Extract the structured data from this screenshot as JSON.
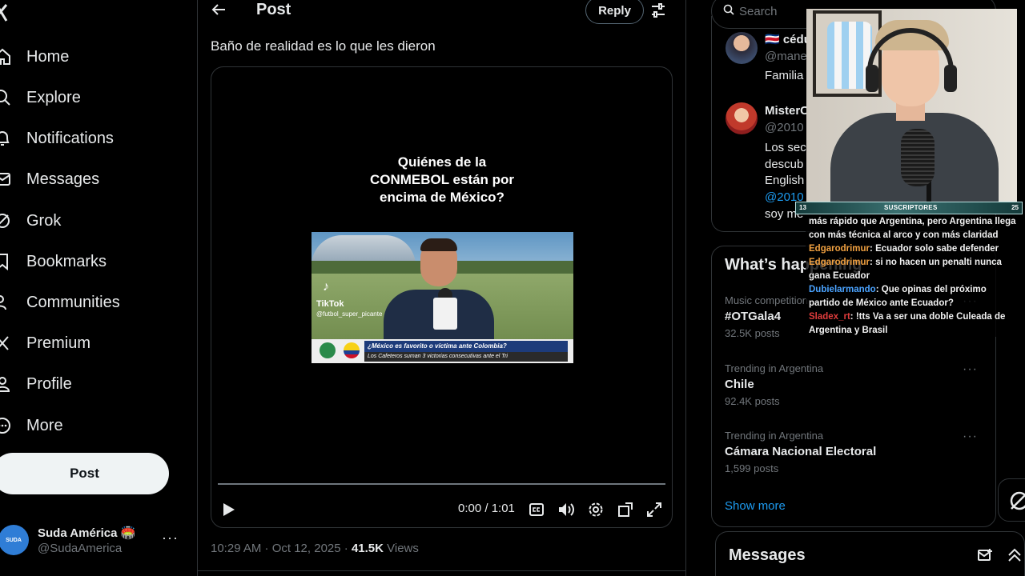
{
  "nav": {
    "items": [
      {
        "label": "Home",
        "icon": "home-icon"
      },
      {
        "label": "Explore",
        "icon": "search-icon"
      },
      {
        "label": "Notifications",
        "icon": "bell-icon"
      },
      {
        "label": "Messages",
        "icon": "envelope-icon"
      },
      {
        "label": "Grok",
        "icon": "grok-icon"
      },
      {
        "label": "Bookmarks",
        "icon": "bookmark-icon"
      },
      {
        "label": "Communities",
        "icon": "people-icon"
      },
      {
        "label": "Premium",
        "icon": "x-logo-icon"
      },
      {
        "label": "Profile",
        "icon": "person-icon"
      },
      {
        "label": "More",
        "icon": "more-circle-icon"
      }
    ],
    "post_button": "Post",
    "account": {
      "name": "Suda América 🏟️",
      "handle": "@SudaAmerica",
      "more": "···"
    }
  },
  "header": {
    "title": "Post",
    "reply_button": "Reply"
  },
  "tweet": {
    "text": "Baño de realidad es lo que les dieron",
    "video": {
      "question_lines": [
        "Quiénes de la",
        "CONMEBOL están por",
        "encima de México?"
      ],
      "thumb_tiktok": "TikTok",
      "thumb_handle": "@futbol_super_picante",
      "thumb_headline": "¿México es favorito o víctima ante Colombia?",
      "thumb_subline": "Los Cafeteros suman 3 victorias consecutivas ante el Tri",
      "time": "0:00 / 1:01",
      "progress": 0
    },
    "timestamp": "10:29 AM · Oct 12, 2025 · ",
    "views_count": "41.5K",
    "views_label": " Views"
  },
  "search": {
    "placeholder": "Search"
  },
  "replies": [
    {
      "name": "🇨🇷 cédu",
      "handle": "@mane",
      "lines": [
        "Familia"
      ]
    },
    {
      "name": "MisterC",
      "handle": "@2010",
      "lines": [
        "Los sec",
        "descub",
        "English",
        "@2010",
        "soy me"
      ]
    }
  ],
  "trends": {
    "title": "What’s happening",
    "items": [
      {
        "category": "Music competition",
        "name": "#OTGala4",
        "count": "32.5K posts"
      },
      {
        "category": "Trending in Argentina",
        "name": "Chile",
        "count": "92.4K posts"
      },
      {
        "category": "Trending in Argentina",
        "name": "Cámara Nacional Electoral",
        "count": "1,599 posts"
      }
    ],
    "show_more": "Show more"
  },
  "messages": {
    "title": "Messages"
  },
  "overlay": {
    "sub_left": "13",
    "sub_label": "SUSCRIPTORES",
    "sub_right": "25",
    "chat": [
      {
        "user": "",
        "text": "más rápido que Argentina, pero Argentina llega"
      },
      {
        "user": "",
        "text": "con más técnica al arco y con más claridad"
      },
      {
        "user": "Edgarodrimur",
        "sep": ": ",
        "text": " Ecuador solo sabe defender",
        "color": "orange"
      },
      {
        "user": "Edgarodrimur",
        "sep": ": ",
        "text": " si no hacen un penalti nunca",
        "color": "orange"
      },
      {
        "user": "",
        "text": "gana Ecuador"
      },
      {
        "user": "Dubielarmando",
        "sep": ": ",
        "text": " Que opinas del próximo",
        "color": "blue"
      },
      {
        "user": "",
        "text": "partido de México ante Ecuador?"
      },
      {
        "user": "Sladex_rt",
        "sep": ": ",
        "text": " !tts Va a ser una doble Culeada de",
        "color": "red"
      },
      {
        "user": "",
        "text": "Argentina y Brasil"
      }
    ]
  },
  "colors": {
    "accent": "#1d9bf0",
    "background": "#000000",
    "border": "#2f3336",
    "muted": "#71767b"
  }
}
